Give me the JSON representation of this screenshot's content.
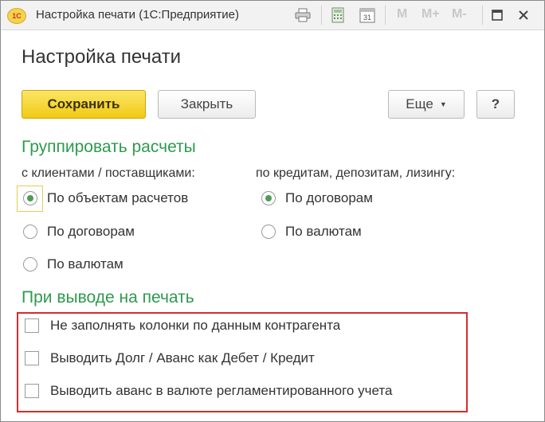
{
  "window": {
    "title": "Настройка печати  (1С:Предприятие)",
    "logo_text": "1С",
    "toolbar_icons": [
      "printer-icon",
      "calculator-icon",
      "calendar-icon"
    ],
    "calendar_day": "31",
    "memory_buttons": [
      "M",
      "M+",
      "M-"
    ],
    "controls": [
      "minimize-icon",
      "maximize-icon",
      "close-icon"
    ]
  },
  "form": {
    "title": "Настройка печати",
    "buttons": {
      "save": "Сохранить",
      "close": "Закрыть",
      "more": "Еще",
      "help": "?"
    },
    "group_section": {
      "title": "Группировать расчеты",
      "left_label": "с клиентами / поставщиками:",
      "left_options": [
        "По объектам расчетов",
        "По договорам",
        "По валютам"
      ],
      "left_selected": 0,
      "right_label": "по кредитам, депозитам, лизингу:",
      "right_options": [
        "По договорам",
        "По валютам"
      ],
      "right_selected": 0
    },
    "print_section": {
      "title": "При выводе на печать",
      "checkboxes": [
        {
          "label": "Не заполнять колонки по данным контрагента",
          "checked": false
        },
        {
          "label": "Выводить Долг / Аванс как Дебет / Кредит",
          "checked": false
        },
        {
          "label": "Выводить аванс в валюте регламентированного учета",
          "checked": false
        }
      ]
    }
  },
  "colors": {
    "accent_green": "#2e9a4e",
    "primary_button": "#f2ca14",
    "highlight_frame": "#d62b2b"
  }
}
